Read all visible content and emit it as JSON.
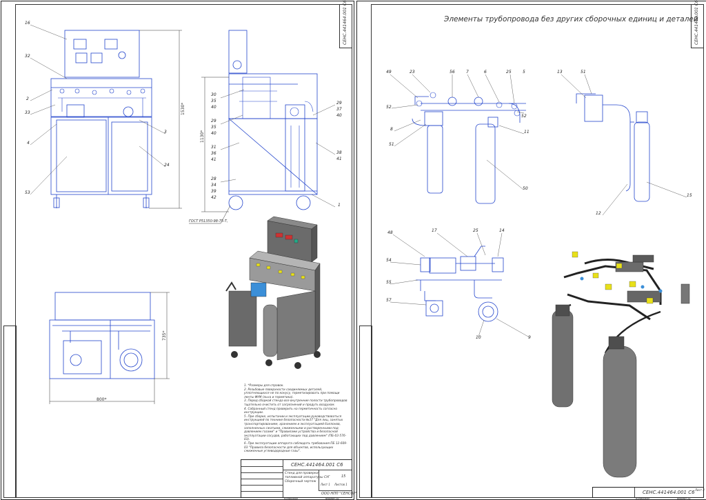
{
  "left_sheet": {
    "code": "CEHC.441464.001 C6",
    "title_block": {
      "code": "CEHC.441464.001 C6",
      "name_line1": "Стенд для проверки",
      "name_line2": "топливной аппаратуры СУГ",
      "name_line3": "Сборочный чертеж",
      "org": "ООО НПП \"СЕНСОР\"",
      "mass": "15",
      "sheet_label": "Лист 1",
      "sheets_label": "Листов 1",
      "format": "Формат А1",
      "copied": "Копировал"
    },
    "dimensions": {
      "overall_height": "1530*",
      "side_height": "1130*",
      "plan_width": "800*",
      "plan_depth": "735*"
    },
    "standard_note": "ГОСТ Р51350-98-75-Т,",
    "balloons_front": [
      "16",
      "32",
      "2",
      "33",
      "4",
      "53",
      "3",
      "24"
    ],
    "balloons_side_left": [
      "30",
      "35",
      "40",
      "29",
      "35",
      "40",
      "31",
      "36",
      "41",
      "28",
      "34",
      "39",
      "42"
    ],
    "balloons_side_right": [
      "29",
      "37",
      "40",
      "38",
      "41",
      "1"
    ],
    "notes": [
      "1. *Размеры для справок.",
      "2. Резьбовые поверхности соединяемых деталей, уплотняющихся не по конусу, герметизировать при помощи ленты ФУМ (льна и герметика).",
      "3. Перед сборкой стенда все внутренние полости трубопроводов тщательно очистить от загрязнений и продуть воздухом.",
      "4. Собранный стенд проверить на герметичность согласно инструкции.",
      "5. При сборке, испытании и эксплуатации руководствоваться инструкцией по технике безопасности №37 \"Для лиц, занятых транспортированием, хранением и эксплуатацией баллонов, заполненных сжатыми, сжиженными и растворенными под давлением газами\" и \"Правилами устройства и безопасной эксплуатации сосудов, работающих под давлением\" (ПБ-03-576-03).",
      "6. При эксплуатации аппарата соблюдать требования ПБ 12-609-03 \"Правила безопасности для объектов, использующих сжиженные углеводородные газы\"."
    ]
  },
  "right_sheet": {
    "code": "CEHC.441464.001 C6",
    "heading": "Элементы трубопровода без других сборочных единиц и деталей",
    "title_block": {
      "code": "CEHC.441464.001 C6",
      "sheet_label": "Лист 2",
      "format": "Формат А1",
      "copied": "Копировал"
    },
    "balloons_group1": [
      "49",
      "23",
      "56",
      "7",
      "6",
      "25",
      "5",
      "52",
      "52",
      "8",
      "51",
      "11",
      "50"
    ],
    "balloons_group2": [
      "13",
      "51",
      "12",
      "15"
    ],
    "balloons_group3": [
      "48",
      "17",
      "25",
      "14",
      "54",
      "55",
      "57",
      "10",
      "9"
    ]
  },
  "colors": {
    "line": "#2244cc",
    "ink": "#222222",
    "steel": "#6b6b6b",
    "accent": "#e8e01a"
  }
}
